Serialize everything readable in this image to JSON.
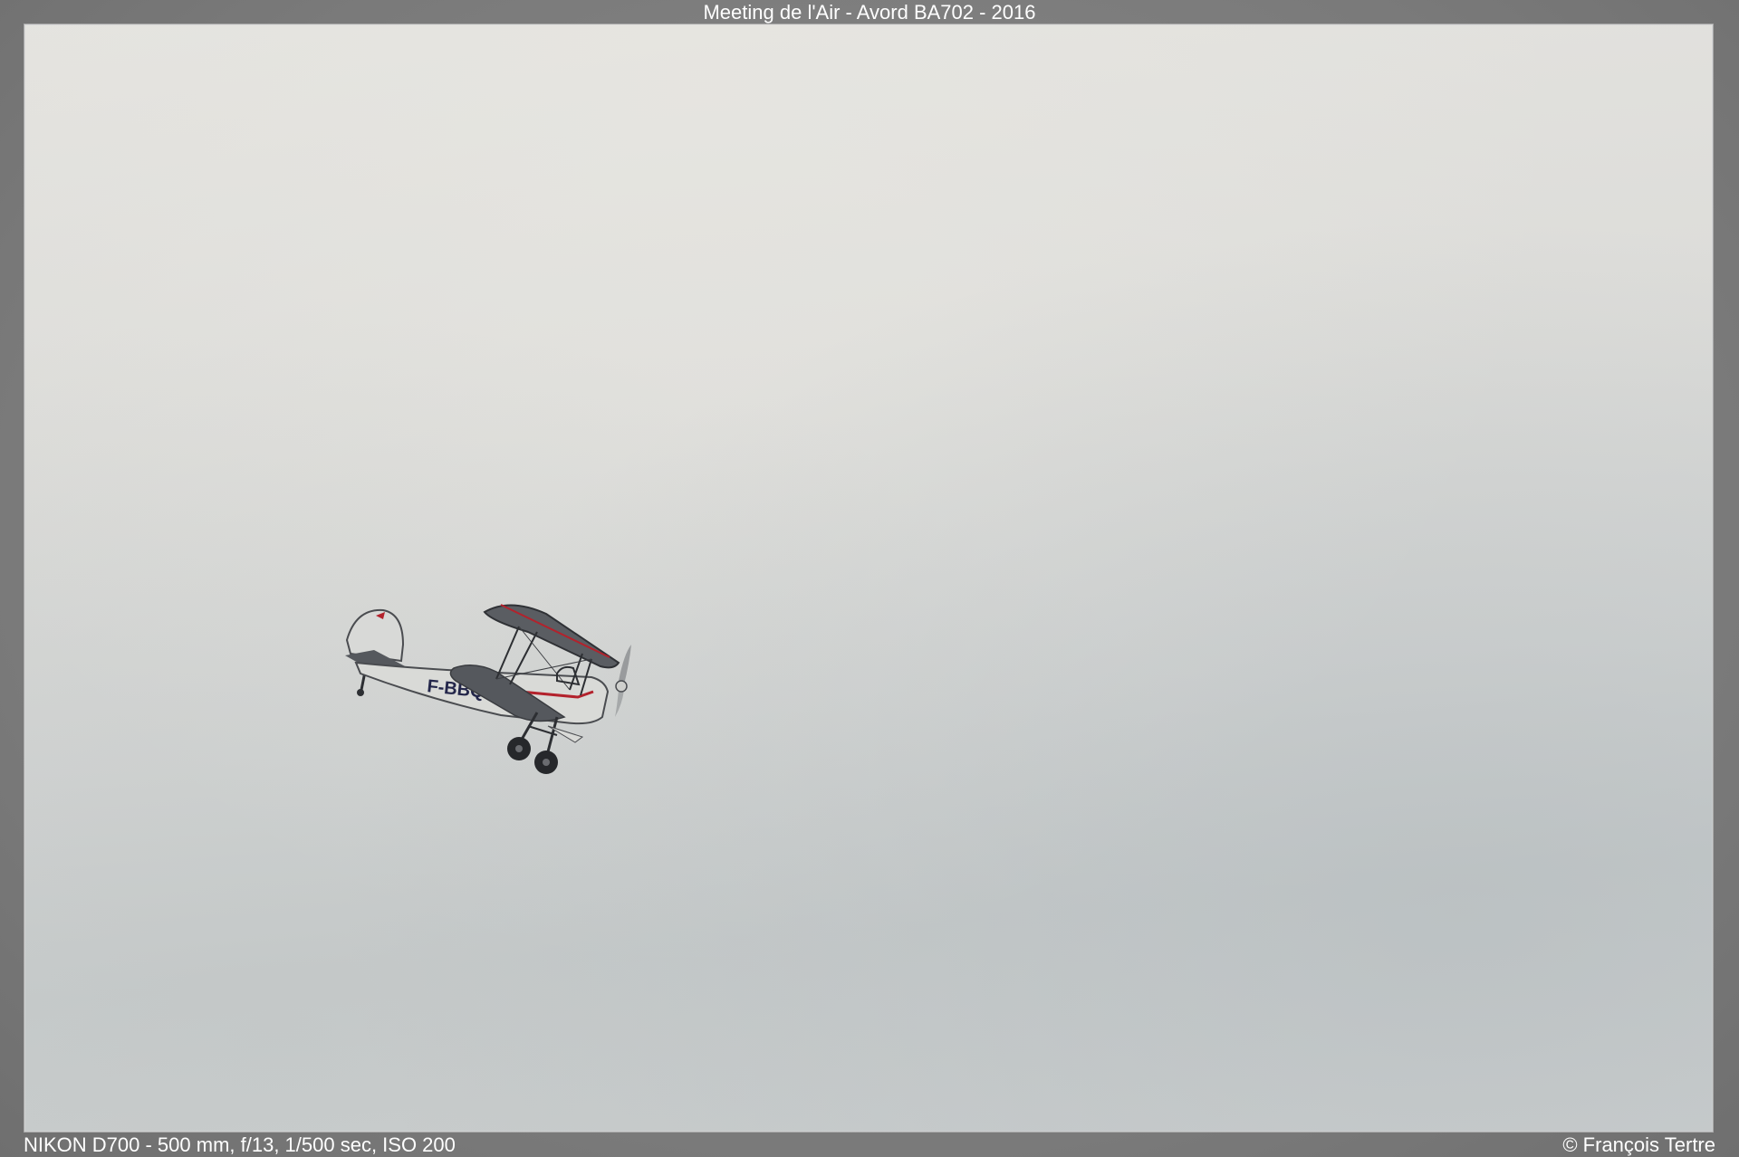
{
  "header": {
    "title": "Meeting de l'Air - Avord BA702 - 2016"
  },
  "photo": {
    "subject_icon": "biplane-icon",
    "aircraft_registration": "F-BBQ",
    "colors": {
      "sky": "#dcdcd9",
      "fuselage": "#d9d9d6",
      "wing_dark": "#5a5d62",
      "accent_red": "#b3222c",
      "frame": "#7e7e7e"
    }
  },
  "footer": {
    "exif": "NIKON D700 - 500 mm, f/13, 1/500 sec, ISO 200",
    "copyright": "© François Tertre"
  }
}
